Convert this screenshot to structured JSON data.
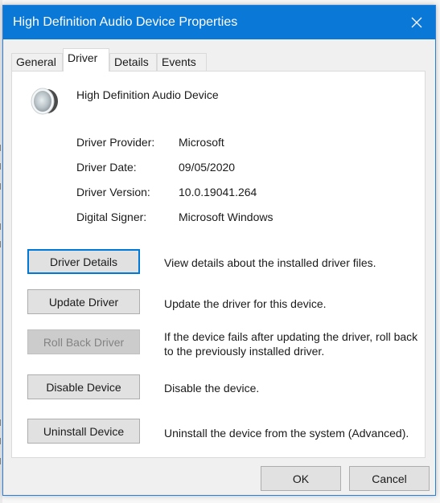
{
  "window": {
    "title": "High Definition Audio Device Properties",
    "close_icon": "close-icon",
    "accent_color": "#0a78d7"
  },
  "tabs": [
    {
      "label": "General",
      "active": false
    },
    {
      "label": "Driver",
      "active": true
    },
    {
      "label": "Details",
      "active": false
    },
    {
      "label": "Events",
      "active": false
    }
  ],
  "device": {
    "icon": "speaker-icon",
    "name": "High Definition Audio Device"
  },
  "properties": [
    {
      "label": "Driver Provider:",
      "value": "Microsoft"
    },
    {
      "label": "Driver Date:",
      "value": "09/05/2020"
    },
    {
      "label": "Driver Version:",
      "value": "10.0.19041.264"
    },
    {
      "label": "Digital Signer:",
      "value": "Microsoft Windows"
    }
  ],
  "actions": [
    {
      "label": "Driver Details",
      "description": "View details about the installed driver files.",
      "enabled": true,
      "focused": true
    },
    {
      "label": "Update Driver",
      "description": "Update the driver for this device.",
      "enabled": true,
      "focused": false
    },
    {
      "label": "Roll Back Driver",
      "description": "If the device fails after updating the driver, roll back to the previously installed driver.",
      "enabled": false,
      "focused": false
    },
    {
      "label": "Disable Device",
      "description": "Disable the device.",
      "enabled": true,
      "focused": false
    },
    {
      "label": "Uninstall Device",
      "description": "Uninstall the device from the system (Advanced).",
      "enabled": true,
      "focused": false
    }
  ],
  "footer": {
    "ok_label": "OK",
    "cancel_label": "Cancel"
  }
}
